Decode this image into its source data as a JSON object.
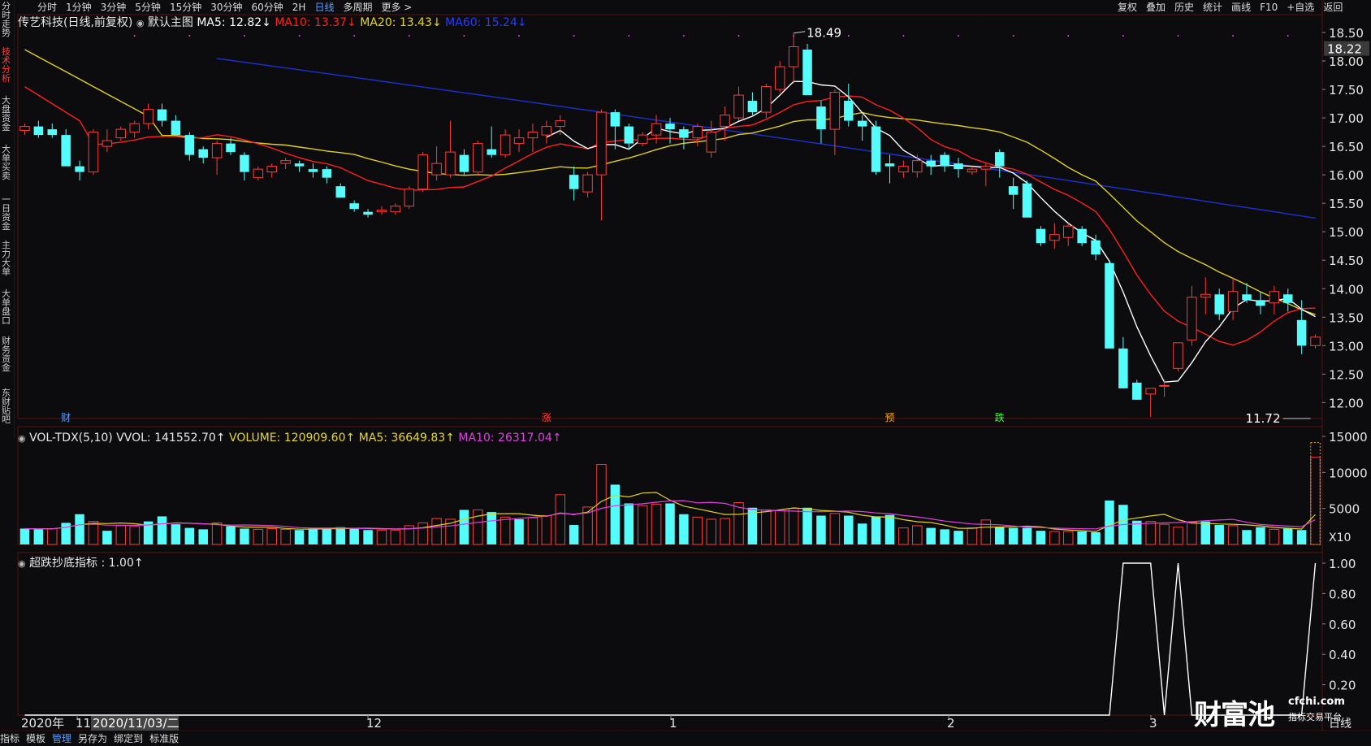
{
  "toolbar": {
    "periods": [
      "分时",
      "1分钟",
      "3分钟",
      "5分钟",
      "15分钟",
      "30分钟",
      "60分钟",
      "2H",
      "日线",
      "多周期",
      "更多 >"
    ],
    "active_period": "日线",
    "right": [
      "复权",
      "叠加",
      "历史",
      "统计",
      "画线",
      "F10",
      "+自选",
      "返回"
    ],
    "tags": [
      "财",
      "涨",
      "预",
      "跌"
    ]
  },
  "left_tabs": [
    "分时走势",
    "技术分析",
    "大盘资金",
    "大单买卖",
    "一日资金",
    "主力大单",
    "大单盘口",
    "财务资金",
    "东财贴吧"
  ],
  "active_left_tab": "技术分析",
  "main_legend": {
    "stock": "传艺科技(日线,前复权)",
    "template": "默认主图",
    "ma5": "MA5: 12.82↓",
    "ma10": "MA10: 13.37↓",
    "ma20": "MA20: 13.43↓",
    "ma60": "MA60: 15.24↓"
  },
  "vol_legend": {
    "name": "VOL-TDX(5,10) VVOL: 141552.70↑",
    "volume": "VOLUME: 120909.60↑",
    "ma5": "MA5: 36649.83↑",
    "ma10": "MA10: 26317.04↑"
  },
  "ind_legend": {
    "name": "超跌抄底指标 : 1.00↑"
  },
  "price_high_label": "18.49",
  "price_low_label": "11.72",
  "current_price": "18.22",
  "vol_unit": "X10",
  "bottom_period": "日线",
  "xaxis": {
    "year_label": "2020年",
    "crosshair_date": "2020/11/03/二"
  },
  "bottombar": [
    "指标",
    "模板",
    "管理",
    "另存为",
    "绑定到",
    "标准版"
  ],
  "bottombar_active": "管理",
  "logo": {
    "name": "财富池",
    "site": "cfchi.com",
    "sub": "指标交易平台"
  },
  "colors": {
    "up": "#ff3b3b",
    "down": "#54fcfc",
    "ma5": "#ffffff",
    "ma10": "#ff2020",
    "ma20": "#e0d020",
    "ma60": "#2030d0",
    "vma10": "#e040e0"
  },
  "chart_data": [
    {
      "type": "candlestick",
      "ylim": [
        11.72,
        18.5
      ],
      "yticks": [
        12.0,
        12.5,
        13.0,
        13.5,
        14.0,
        14.5,
        15.0,
        15.5,
        16.0,
        16.5,
        17.0,
        17.5,
        18.0,
        18.5
      ],
      "xlabels": [
        "11",
        "12",
        "1",
        "2",
        "3"
      ],
      "x": [
        "1",
        "2",
        "3",
        "4",
        "5",
        "6",
        "7",
        "8",
        "9",
        "10",
        "11",
        "12",
        "13",
        "14",
        "15",
        "16",
        "17",
        "18",
        "19",
        "20",
        "21",
        "22",
        "23",
        "24",
        "25",
        "26",
        "27",
        "28",
        "29",
        "30",
        "31",
        "32",
        "33",
        "34",
        "35",
        "36",
        "37",
        "38",
        "39",
        "40",
        "41",
        "42",
        "43",
        "44",
        "45",
        "46",
        "47",
        "48",
        "49",
        "50",
        "51",
        "52",
        "53",
        "54",
        "55",
        "56",
        "57",
        "58",
        "59",
        "60",
        "61",
        "62",
        "63",
        "64",
        "65",
        "66",
        "67",
        "68",
        "69",
        "70",
        "71",
        "72",
        "73",
        "74",
        "75",
        "76",
        "77",
        "78",
        "79",
        "80",
        "81",
        "82",
        "83",
        "84",
        "85",
        "86",
        "87",
        "88",
        "89",
        "90",
        "91",
        "92",
        "93",
        "94",
        "95"
      ],
      "ohlc": [
        [
          16.78,
          16.9,
          16.7,
          16.85
        ],
        [
          16.85,
          16.95,
          16.65,
          16.7
        ],
        [
          16.8,
          16.9,
          16.65,
          16.7
        ],
        [
          16.7,
          16.8,
          16.25,
          16.15
        ],
        [
          16.15,
          16.25,
          15.9,
          16.05
        ],
        [
          16.05,
          16.8,
          16.0,
          16.75
        ],
        [
          16.5,
          16.8,
          16.4,
          16.6
        ],
        [
          16.65,
          16.85,
          16.6,
          16.8
        ],
        [
          16.75,
          16.95,
          16.65,
          16.9
        ],
        [
          16.9,
          17.25,
          16.8,
          17.15
        ],
        [
          17.15,
          17.25,
          16.85,
          16.95
        ],
        [
          16.95,
          17.05,
          16.7,
          16.7
        ],
        [
          16.7,
          16.75,
          16.25,
          16.35
        ],
        [
          16.45,
          16.5,
          16.2,
          16.3
        ],
        [
          16.3,
          16.6,
          16.0,
          16.55
        ],
        [
          16.55,
          16.65,
          16.35,
          16.4
        ],
        [
          16.35,
          16.4,
          15.9,
          16.05
        ],
        [
          15.95,
          16.15,
          15.9,
          16.1
        ],
        [
          16.05,
          16.2,
          15.95,
          16.15
        ],
        [
          16.2,
          16.3,
          16.1,
          16.25
        ],
        [
          16.2,
          16.25,
          16.05,
          16.15
        ],
        [
          16.1,
          16.2,
          15.95,
          16.05
        ],
        [
          16.1,
          16.15,
          15.85,
          15.95
        ],
        [
          15.8,
          15.85,
          15.6,
          15.6
        ],
        [
          15.5,
          15.55,
          15.35,
          15.4
        ],
        [
          15.35,
          15.4,
          15.25,
          15.3
        ],
        [
          15.35,
          15.45,
          15.3,
          15.38
        ],
        [
          15.35,
          15.5,
          15.3,
          15.45
        ],
        [
          15.45,
          15.8,
          15.4,
          15.75
        ],
        [
          15.75,
          16.4,
          15.7,
          16.35
        ],
        [
          16.0,
          16.5,
          15.9,
          16.2
        ],
        [
          16.0,
          16.95,
          15.95,
          16.4
        ],
        [
          16.35,
          16.45,
          16.0,
          16.05
        ],
        [
          16.05,
          16.6,
          16.0,
          16.55
        ],
        [
          16.45,
          16.85,
          16.3,
          16.35
        ],
        [
          16.35,
          16.8,
          16.3,
          16.7
        ],
        [
          16.55,
          16.8,
          16.4,
          16.65
        ],
        [
          16.65,
          16.9,
          16.4,
          16.75
        ],
        [
          16.7,
          16.95,
          16.55,
          16.85
        ],
        [
          16.85,
          17.05,
          16.7,
          16.95
        ],
        [
          16.0,
          16.15,
          15.55,
          15.75
        ],
        [
          15.7,
          16.05,
          15.6,
          16.0
        ],
        [
          16.0,
          17.15,
          15.2,
          17.1
        ],
        [
          17.1,
          17.15,
          16.45,
          16.85
        ],
        [
          16.85,
          16.9,
          16.45,
          16.55
        ],
        [
          16.55,
          16.75,
          16.5,
          16.7
        ],
        [
          16.7,
          17.05,
          16.55,
          16.9
        ],
        [
          16.9,
          17.0,
          16.55,
          16.8
        ],
        [
          16.8,
          16.85,
          16.45,
          16.65
        ],
        [
          16.65,
          16.9,
          16.5,
          16.85
        ],
        [
          16.4,
          16.95,
          16.3,
          16.75
        ],
        [
          16.85,
          17.2,
          16.6,
          17.05
        ],
        [
          17.0,
          17.55,
          16.95,
          17.4
        ],
        [
          17.3,
          17.45,
          17.05,
          17.1
        ],
        [
          17.1,
          17.6,
          17.0,
          17.55
        ],
        [
          17.5,
          18.0,
          17.45,
          17.9
        ],
        [
          17.9,
          18.49,
          17.6,
          18.25
        ],
        [
          18.2,
          18.3,
          17.45,
          17.4
        ],
        [
          17.2,
          17.3,
          16.55,
          16.8
        ],
        [
          16.8,
          17.5,
          16.35,
          17.45
        ],
        [
          17.3,
          17.6,
          16.85,
          16.95
        ],
        [
          16.95,
          17.05,
          16.6,
          16.85
        ],
        [
          16.85,
          16.95,
          16.0,
          16.05
        ],
        [
          16.2,
          16.35,
          15.85,
          16.15
        ],
        [
          16.05,
          16.25,
          15.95,
          16.15
        ],
        [
          16.05,
          16.35,
          15.95,
          16.25
        ],
        [
          16.25,
          16.35,
          16.0,
          16.15
        ],
        [
          16.35,
          16.4,
          16.05,
          16.15
        ],
        [
          16.2,
          16.3,
          15.95,
          16.1
        ],
        [
          16.05,
          16.15,
          16.0,
          16.1
        ],
        [
          16.1,
          16.2,
          15.8,
          16.15
        ],
        [
          16.4,
          16.45,
          15.95,
          16.15
        ],
        [
          15.8,
          15.95,
          15.4,
          15.65
        ],
        [
          15.85,
          15.9,
          15.5,
          15.25
        ],
        [
          15.05,
          15.1,
          14.75,
          14.8
        ],
        [
          14.85,
          15.15,
          14.7,
          14.95
        ],
        [
          14.9,
          15.15,
          14.75,
          15.1
        ],
        [
          15.05,
          15.1,
          14.75,
          14.8
        ],
        [
          14.85,
          14.95,
          14.5,
          14.6
        ],
        [
          14.45,
          14.5,
          13.05,
          12.95
        ],
        [
          12.95,
          13.15,
          12.25,
          12.25
        ],
        [
          12.35,
          12.4,
          12.05,
          12.05
        ],
        [
          12.15,
          12.25,
          11.75,
          12.25
        ],
        [
          12.3,
          12.4,
          12.1,
          12.3
        ],
        [
          12.6,
          13.05,
          12.55,
          13.05
        ],
        [
          13.1,
          14.05,
          13.0,
          13.85
        ],
        [
          13.85,
          14.2,
          13.55,
          13.9
        ],
        [
          13.9,
          14.0,
          13.45,
          13.55
        ],
        [
          13.6,
          14.2,
          13.45,
          13.95
        ],
        [
          13.9,
          14.1,
          13.75,
          13.8
        ],
        [
          13.8,
          13.95,
          13.55,
          13.7
        ],
        [
          13.75,
          14.05,
          13.55,
          13.95
        ],
        [
          13.9,
          14.0,
          13.6,
          13.75
        ],
        [
          13.45,
          13.8,
          12.85,
          13.0
        ],
        [
          13.0,
          13.2,
          12.95,
          13.15
        ]
      ]
    },
    {
      "type": "bar",
      "name": "VOL-TDX",
      "ylim": [
        0,
        15000
      ],
      "yticks": [
        5000,
        10000,
        15000
      ],
      "values": [
        2200,
        2100,
        2200,
        3000,
        4200,
        3200,
        1900,
        2600,
        2500,
        3200,
        3900,
        2800,
        2300,
        2100,
        3000,
        2500,
        2200,
        2100,
        2200,
        2100,
        2000,
        2200,
        2300,
        2400,
        2300,
        2000,
        2000,
        2000,
        2600,
        3000,
        3600,
        3500,
        4800,
        4800,
        4500,
        3800,
        3500,
        3700,
        4000,
        6900,
        2700,
        5200,
        11100,
        8300,
        5700,
        5400,
        5600,
        5700,
        4200,
        3800,
        3500,
        3600,
        5800,
        5100,
        4800,
        4700,
        5000,
        5100,
        4000,
        4300,
        4000,
        2900,
        3900,
        4100,
        2300,
        2600,
        2300,
        2100,
        1900,
        2300,
        3400,
        2400,
        2300,
        2300,
        1900,
        1800,
        1800,
        1800,
        1700,
        6100,
        5500,
        3300,
        3200,
        2800,
        2400,
        3100,
        3200,
        2700,
        2600,
        2000,
        2400,
        2100,
        2200,
        2000,
        12100
      ],
      "up": [
        false,
        false,
        true,
        false,
        false,
        true,
        false,
        true,
        true,
        false,
        false,
        false,
        false,
        false,
        true,
        false,
        false,
        true,
        true,
        true,
        false,
        false,
        false,
        false,
        false,
        false,
        true,
        true,
        true,
        true,
        true,
        true,
        false,
        true,
        false,
        true,
        false,
        true,
        true,
        true,
        false,
        true,
        true,
        false,
        false,
        true,
        true,
        false,
        false,
        true,
        true,
        true,
        true,
        false,
        true,
        true,
        true,
        false,
        false,
        true,
        false,
        false,
        false,
        false,
        true,
        true,
        false,
        false,
        false,
        true,
        true,
        false,
        false,
        false,
        false,
        true,
        true,
        false,
        false,
        false,
        false,
        false,
        true,
        true,
        true,
        true,
        false,
        false,
        true,
        false,
        false,
        true,
        false,
        false,
        true
      ]
    },
    {
      "type": "line",
      "name": "超跌抄底指标",
      "ylim": [
        0,
        1.0
      ],
      "yticks": [
        0.2,
        0.4,
        0.6,
        0.8,
        1.0
      ],
      "values": [
        0,
        0,
        0,
        0,
        0,
        0,
        0,
        0,
        0,
        0,
        0,
        0,
        0,
        0,
        0,
        0,
        0,
        0,
        0,
        0,
        0,
        0,
        0,
        0,
        0,
        0,
        0,
        0,
        0,
        0,
        0,
        0,
        0,
        0,
        0,
        0,
        0,
        0,
        0,
        0,
        0,
        0,
        0,
        0,
        0,
        0,
        0,
        0,
        0,
        0,
        0,
        0,
        0,
        0,
        0,
        0,
        0,
        0,
        0,
        0,
        0,
        0,
        0,
        0,
        0,
        0,
        0,
        0,
        0,
        0,
        0,
        0,
        0,
        0,
        0,
        0,
        0,
        0,
        0,
        0,
        1,
        1,
        1,
        0,
        1,
        0,
        0,
        0,
        0,
        0,
        0,
        0,
        0,
        0,
        1
      ]
    }
  ]
}
